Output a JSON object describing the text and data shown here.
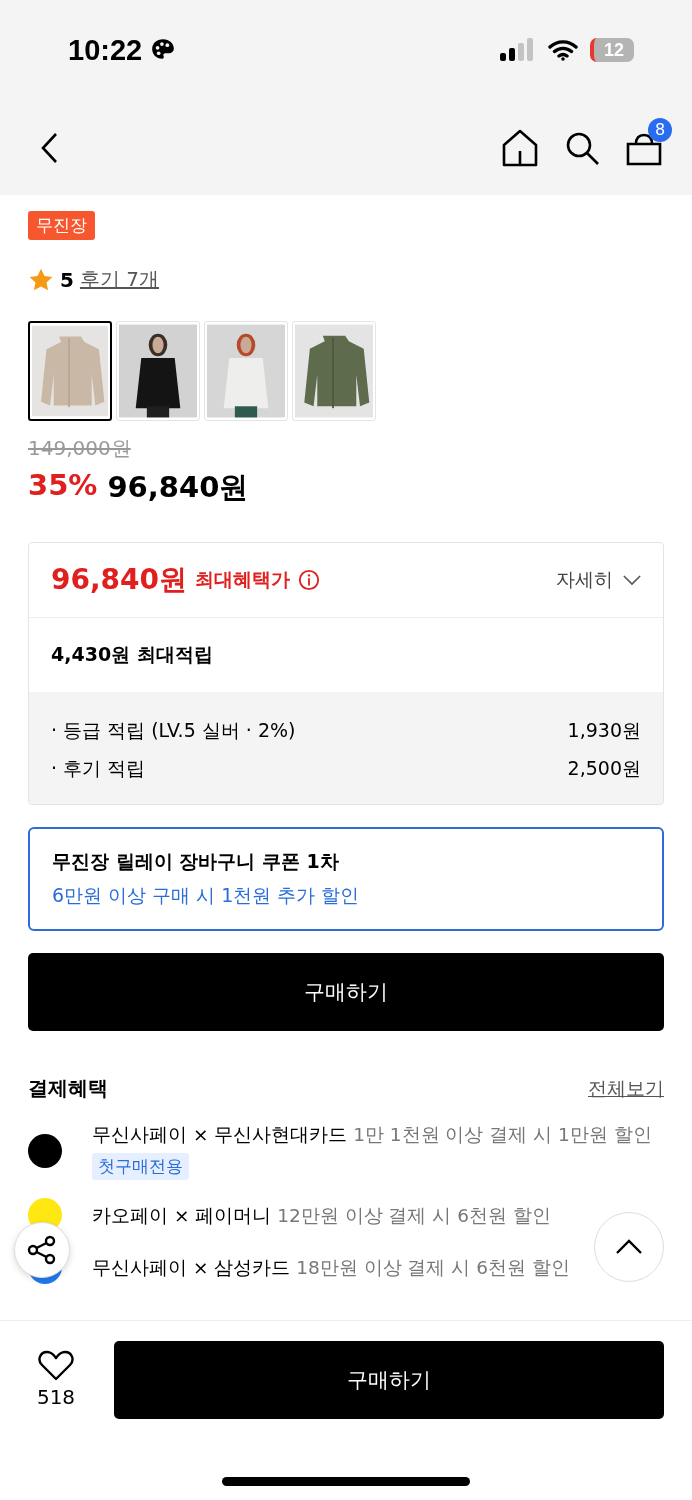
{
  "status_bar": {
    "time": "10:22",
    "battery": "12"
  },
  "nav": {
    "cart_count": "8"
  },
  "product": {
    "badge": "무진장",
    "rating": "5",
    "reviews": "후기 7개",
    "thumbnails": [
      {
        "kind": "picture",
        "selected": true
      },
      {
        "kind": "picture",
        "selected": false
      },
      {
        "kind": "picture",
        "selected": false
      },
      {
        "kind": "picture",
        "selected": false
      }
    ],
    "original_price": "149,000원",
    "discount": "35%",
    "price": "96,840원"
  },
  "benefit": {
    "price": "96,840원",
    "label": "최대혜택가",
    "details": "자세히",
    "points_total": "4,430원 최대적립",
    "points": [
      {
        "label": "· 등급 적립 (LV.5 실버 · 2%)",
        "value": "1,930원"
      },
      {
        "label": "· 후기 적립",
        "value": "2,500원"
      }
    ]
  },
  "coupon": {
    "title": "무진장 릴레이 장바구니 쿠폰 1차",
    "subtitle": "6만원 이상 구매 시 1천원 추가 할인"
  },
  "buy_button": "구매하기",
  "payment": {
    "title": "결제혜택",
    "see_all": "전체보기",
    "items": [
      {
        "name": "무신사페이 × 무신사현대카드",
        "desc": "1만 1천원 이상 결제 시 1만원 할인",
        "tag": "첫구매전용",
        "color": "#000000"
      },
      {
        "name": "카오페이 × 페이머니",
        "desc": "12만원 이상 결제 시 6천원 할인",
        "color": "#ffe812"
      },
      {
        "name": "무신사페이 × 삼성카드",
        "desc": "18만원 이상 결제 시 6천원 할인",
        "color": "#1e7cf2"
      }
    ]
  },
  "bottom_bar": {
    "likes": "518",
    "buy": "구매하기"
  }
}
